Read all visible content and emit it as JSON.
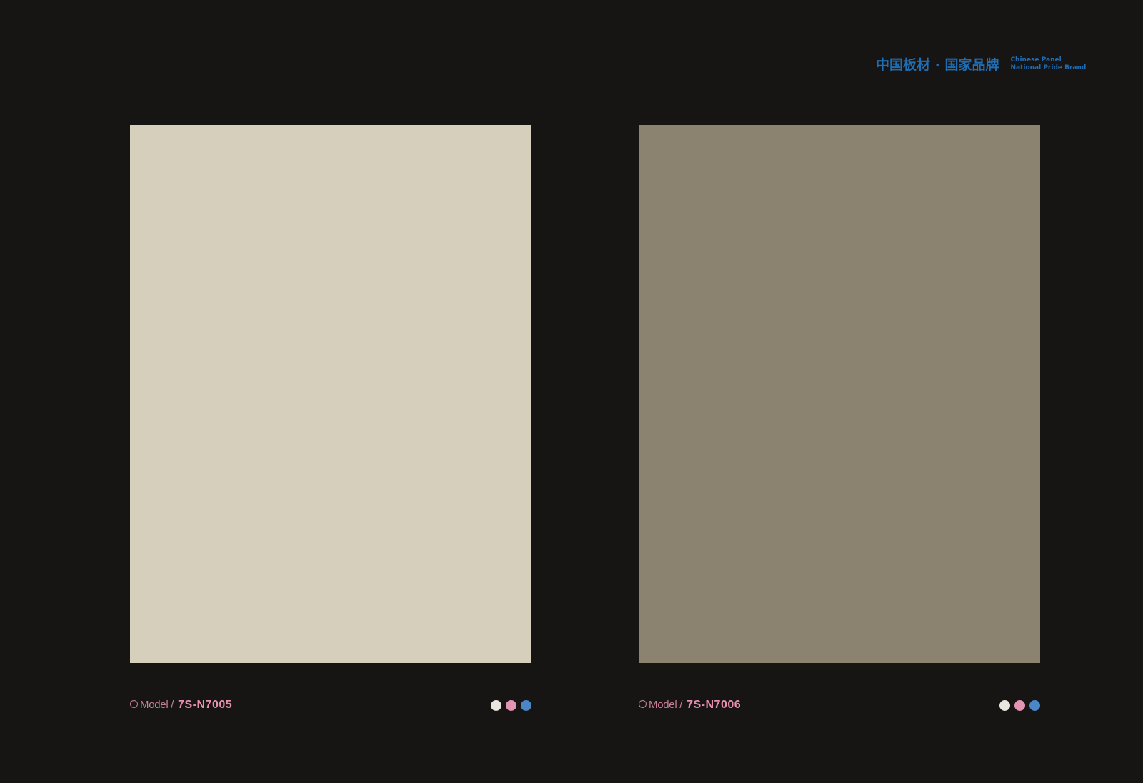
{
  "brand": {
    "cn": "中国板材 · 国家品牌",
    "en_line1": "Chinese Panel",
    "en_line2": "National Pride Brand",
    "color": "#1f6db3"
  },
  "samples": [
    {
      "model_prefix": "Model /",
      "model_code": "7S-N7005",
      "swatch_color": "#d5cfbb",
      "dot_colors": [
        "#e9e6df",
        "#e394b2",
        "#4b86c6"
      ]
    },
    {
      "model_prefix": "Model /",
      "model_code": "7S-N7006",
      "swatch_color": "#8c8270",
      "dot_colors": [
        "#e9e6df",
        "#e394b2",
        "#4b86c6"
      ]
    }
  ]
}
